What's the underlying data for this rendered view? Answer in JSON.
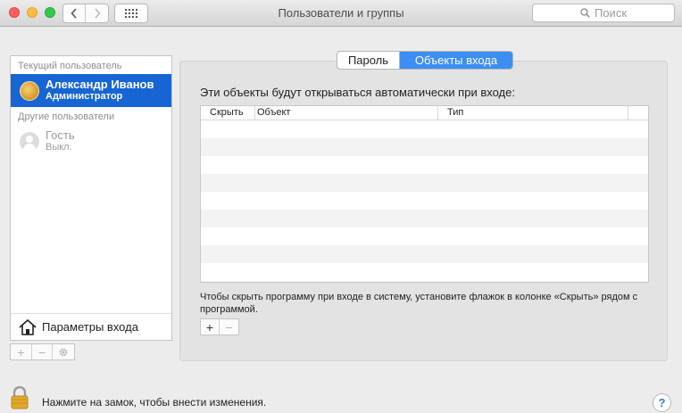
{
  "window": {
    "title": "Пользователи и группы"
  },
  "search": {
    "placeholder": "Поиск"
  },
  "sidebar": {
    "current_header": "Текущий пользователь",
    "current_user": {
      "name": "Александр Иванов",
      "role": "Администратор"
    },
    "other_header": "Другие пользователи",
    "guest_user": {
      "name": "Гость",
      "status": "Выкл."
    },
    "login_options_label": "Параметры входа"
  },
  "tabs": {
    "password": "Пароль",
    "login_items": "Объекты входа"
  },
  "panel": {
    "caption": "Эти объекты будут открываться автоматически при входе:",
    "columns": {
      "hide": "Скрыть",
      "item": "Объект",
      "type": "Тип"
    },
    "hint": "Чтобы скрыть программу при входе в систему, установите флажок в колонке «Скрыть» рядом с программой.",
    "add_label": "+",
    "remove_label": "−"
  },
  "sidebar_toolbar": {
    "add_label": "+",
    "remove_label": "−"
  },
  "footer": {
    "lock_text": "Нажмите на замок, чтобы внести изменения.",
    "help_label": "?"
  },
  "colors": {
    "selection": "#1765d3",
    "segment_active": "#3d8ef3"
  }
}
